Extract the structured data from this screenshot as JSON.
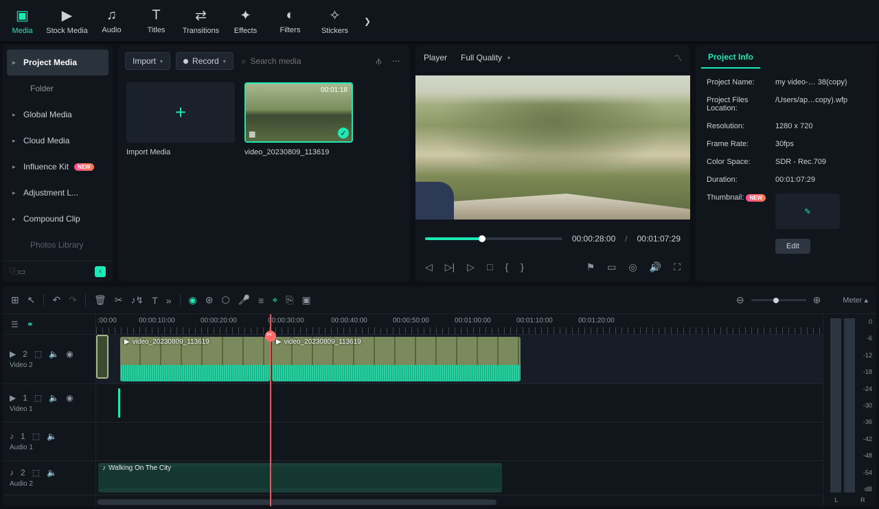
{
  "toolbar": {
    "tabs": [
      {
        "label": "Media",
        "icon": "▣"
      },
      {
        "label": "Stock Media",
        "icon": "▶"
      },
      {
        "label": "Audio",
        "icon": "♫"
      },
      {
        "label": "Titles",
        "icon": "T"
      },
      {
        "label": "Transitions",
        "icon": "⇄"
      },
      {
        "label": "Effects",
        "icon": "✦"
      },
      {
        "label": "Filters",
        "icon": "◐"
      },
      {
        "label": "Stickers",
        "icon": "✧"
      }
    ]
  },
  "sidebar": {
    "items": [
      {
        "label": "Project Media"
      },
      {
        "label": "Folder"
      },
      {
        "label": "Global Media"
      },
      {
        "label": "Cloud Media"
      },
      {
        "label": "Influence Kit"
      },
      {
        "label": "Adjustment L..."
      },
      {
        "label": "Compound Clip"
      },
      {
        "label": "Photos Library"
      }
    ]
  },
  "media": {
    "import_label": "Import",
    "record_label": "Record",
    "search_placeholder": "Search media",
    "import_caption": "Import Media",
    "clip_caption": "video_20230809_113619",
    "clip_duration": "00:01:18"
  },
  "player": {
    "title": "Player",
    "quality": "Full Quality",
    "current_time": "00:00:28:00",
    "total_time": "00:01:07:29"
  },
  "info": {
    "tab": "Project Info",
    "rows": {
      "name_label": "Project Name:",
      "name_value": "my video-… 38(copy)",
      "location_label": "Project Files Location:",
      "location_value": "/Users/ap…copy).wfp",
      "resolution_label": "Resolution:",
      "resolution_value": "1280 x 720",
      "framerate_label": "Frame Rate:",
      "framerate_value": "30fps",
      "colorspace_label": "Color Space:",
      "colorspace_value": "SDR - Rec.709",
      "duration_label": "Duration:",
      "duration_value": "00:01:07:29",
      "thumbnail_label": "Thumbnail:"
    },
    "edit_button": "Edit",
    "new_badge": "NEW"
  },
  "timeline": {
    "meter_label": "Meter ▴",
    "ruler": [
      ":00:00",
      "00:00:10:00",
      "00:00:20:00",
      "00:00:30:00",
      "00:00:40:00",
      "00:00:50:00",
      "00:01:00:00",
      "00:01:10:00",
      "00:01:20:00"
    ],
    "tracks": {
      "video2": {
        "label": "Video 2",
        "num": "2"
      },
      "video1": {
        "label": "Video 1",
        "num": "1"
      },
      "audio1": {
        "label": "Audio 1",
        "num": "1"
      },
      "audio2": {
        "label": "Audio 2",
        "num": "2"
      }
    },
    "clips": {
      "v2a": "video_20230809_113619",
      "v2b": "video_20230809_113619",
      "a2": "Walking On The City"
    },
    "meter_db": [
      "0",
      "-6",
      "-12",
      "-18",
      "-24",
      "-30",
      "-36",
      "-42",
      "-48",
      "-54",
      "dB"
    ],
    "meter_lr": {
      "l": "L",
      "r": "R"
    }
  }
}
